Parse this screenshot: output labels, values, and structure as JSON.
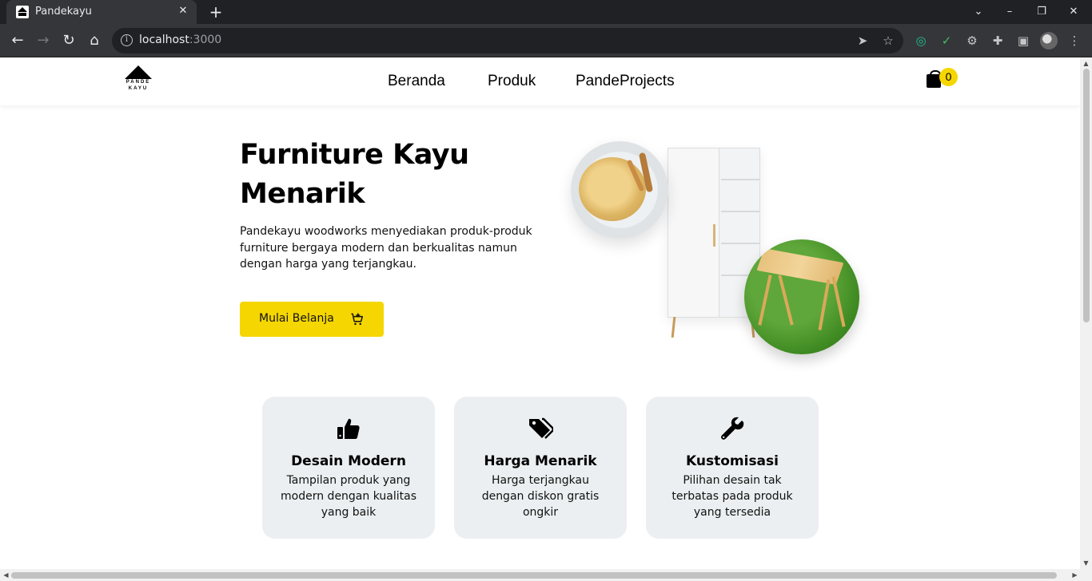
{
  "browser": {
    "tab_title": "Pandekayu",
    "tab_close": "✕",
    "new_tab": "+",
    "url_host": "localhost",
    "url_port": ":3000"
  },
  "header": {
    "logo_line1": "PANDE",
    "logo_line2": "KAYU",
    "nav": [
      "Beranda",
      "Produk",
      "PandeProjects"
    ],
    "cart_count": "0"
  },
  "hero": {
    "title_line1": "Furniture Kayu",
    "title_line2": "Menarik",
    "description": "Pandekayu woodworks menyediakan produk-produk furniture bergaya modern dan berkualitas namun dengan harga yang terjangkau.",
    "cta_label": "Mulai Belanja"
  },
  "features": [
    {
      "icon": "thumbs-up-icon",
      "title": "Desain Modern",
      "description": "Tampilan produk yang modern dengan kualitas yang baik"
    },
    {
      "icon": "tags-icon",
      "title": "Harga Menarik",
      "description": "Harga terjangkau dengan diskon gratis ongkir"
    },
    {
      "icon": "wrench-icon",
      "title": "Kustomisasi",
      "description": "Pilihan desain tak terbatas pada produk yang tersedia"
    }
  ],
  "colors": {
    "accent": "#f5d600",
    "card_bg": "#eceff1",
    "chrome_dark": "#202124",
    "chrome_toolbar": "#35363a"
  }
}
